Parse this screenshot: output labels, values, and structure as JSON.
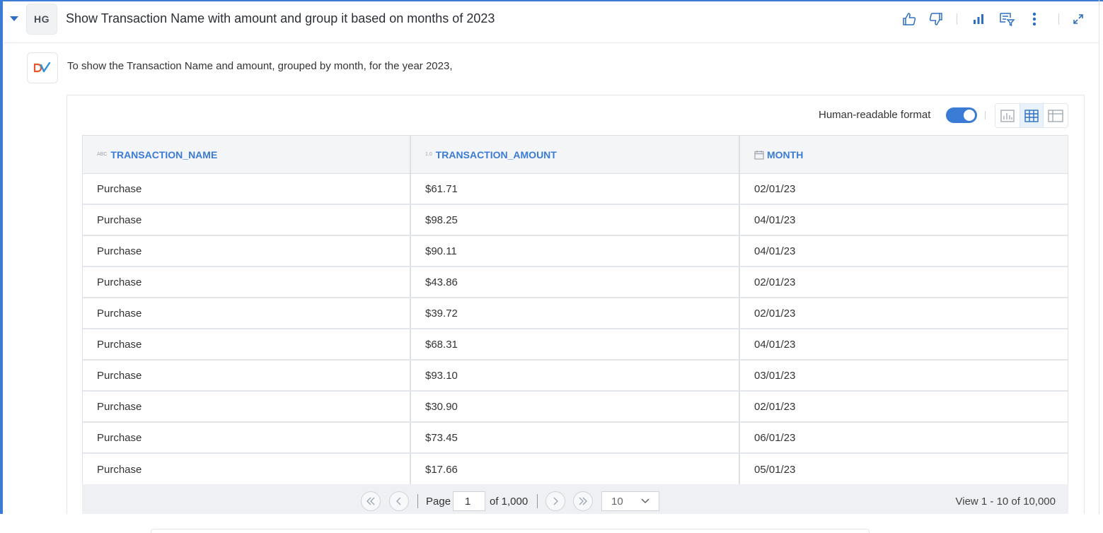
{
  "header": {
    "avatar_initials": "HG",
    "question": "Show Transaction Name with amount and group it based on months of 2023",
    "icons": [
      "thumbs-up-icon",
      "thumbs-down-icon",
      "bar-chart-icon",
      "filter-edit-icon",
      "more-vertical-icon",
      "expand-icon"
    ]
  },
  "answer": {
    "logo_text": "DV",
    "text": "To show the Transaction Name and amount, grouped by month, for the year 2023,"
  },
  "toolbar": {
    "human_readable_label": "Human-readable format",
    "human_readable_enabled": true,
    "views": [
      "chart-view",
      "table-view",
      "pivot-view"
    ],
    "active_view": "table-view"
  },
  "table": {
    "columns": [
      {
        "type_tag": "ABC",
        "label": "TRANSACTION_NAME"
      },
      {
        "type_tag": "1.0",
        "label": "TRANSACTION_AMOUNT"
      },
      {
        "type_tag": "calendar",
        "label": "MONTH"
      }
    ],
    "rows": [
      [
        "Purchase",
        "$61.71",
        "02/01/23"
      ],
      [
        "Purchase",
        "$98.25",
        "04/01/23"
      ],
      [
        "Purchase",
        "$90.11",
        "04/01/23"
      ],
      [
        "Purchase",
        "$43.86",
        "02/01/23"
      ],
      [
        "Purchase",
        "$39.72",
        "02/01/23"
      ],
      [
        "Purchase",
        "$68.31",
        "04/01/23"
      ],
      [
        "Purchase",
        "$93.10",
        "03/01/23"
      ],
      [
        "Purchase",
        "$30.90",
        "02/01/23"
      ],
      [
        "Purchase",
        "$73.45",
        "06/01/23"
      ],
      [
        "Purchase",
        "$17.66",
        "05/01/23"
      ]
    ]
  },
  "pager": {
    "page_label": "Page",
    "page_value": "1",
    "of_label": "of 1,000",
    "page_size": "10",
    "view_label": "View 1 - 10 of 10,000"
  },
  "colors": {
    "accent": "#3a7bd5",
    "header_bg": "#f4f5f7",
    "logo_orange": "#e8552a",
    "logo_blue": "#2f8fd8"
  }
}
